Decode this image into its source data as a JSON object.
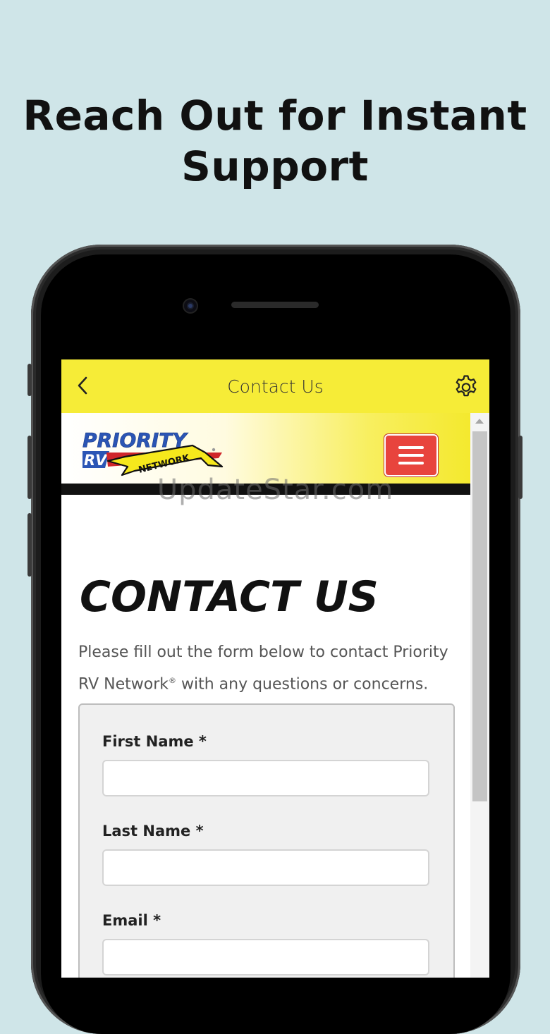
{
  "headline": {
    "line1": "Reach Out for Instant",
    "line2": "Support"
  },
  "appbar": {
    "title": "Contact Us",
    "back_icon": "chevron-left-icon",
    "settings_icon": "gear-icon",
    "background": "#f6ec37"
  },
  "site_header": {
    "logo_text_top": "PRIORITY",
    "logo_text_left": "RV",
    "logo_ribbon": "NETWORK",
    "menu_icon": "hamburger-icon",
    "menu_color": "#e8443d"
  },
  "watermark": "UpdateStar.com",
  "contact": {
    "title": "CONTACT US",
    "desc_part1": "Please fill out the form below to contact Priority RV Network",
    "desc_sup": "®",
    "desc_part2": " with any questions or concerns."
  },
  "form": {
    "fields": [
      {
        "label": "First Name *",
        "value": ""
      },
      {
        "label": "Last Name *",
        "value": ""
      },
      {
        "label": "Email *",
        "value": ""
      }
    ]
  }
}
